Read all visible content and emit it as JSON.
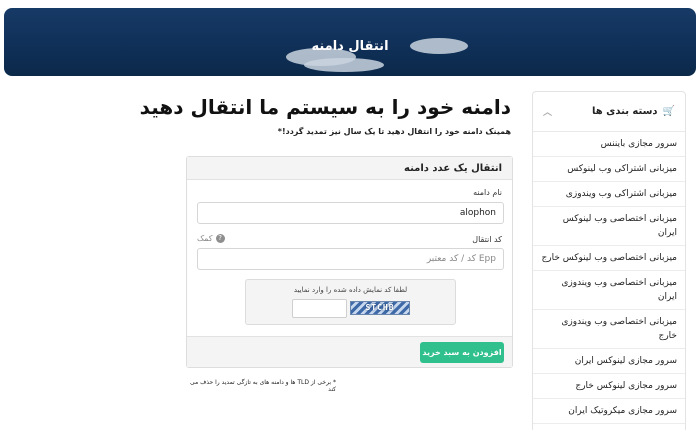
{
  "banner": {
    "title": "انتقال دامنه"
  },
  "main": {
    "title": "دامنه خود را به سیستم ما انتقال دهید",
    "subtitle": "همینک دامنه خود را انتقال دهید تا یک سال نیز تمدید گردد!*"
  },
  "transfer_form": {
    "heading": "انتقال یک عدد دامنه",
    "domain_label": "نام دامنه",
    "domain_value": "alophon",
    "code_label": "کد انتقال",
    "help_label": "کمک",
    "code_placeholder": "Epp کد / کد معتبر",
    "captcha_prompt": "لطفا کد نمایش داده شده را وارد نمایید",
    "captcha_code": "STCHB",
    "captcha_value": "",
    "submit_label": "افزودن به سبد خرید"
  },
  "footnote": "* برخی از TLD ها و دامنه های به تازگی تمدید را حذف می کند",
  "sidebar": {
    "title": "دسته بندی ها",
    "items": [
      "سرور مجازی بایننس",
      "میزبانی اشتراکی وب لینوکس",
      "میزبانی اشتراکی وب ویندوزی",
      "میزبانی اختصاصی وب لینوکس ایران",
      "میزبانی اختصاصی وب لینوکس خارج",
      "میزبانی اختصاصی وب ویندوزی ایران",
      "میزبانی اختصاصی وب ویندوزی خارج",
      "سرور مجازی لینوکس ایران",
      "سرور مجازی لینوکس خارج",
      "سرور مجازی میکروتیک ایران"
    ]
  },
  "colors": {
    "banner": "#0f2f57",
    "submit": "#2fc08d"
  }
}
